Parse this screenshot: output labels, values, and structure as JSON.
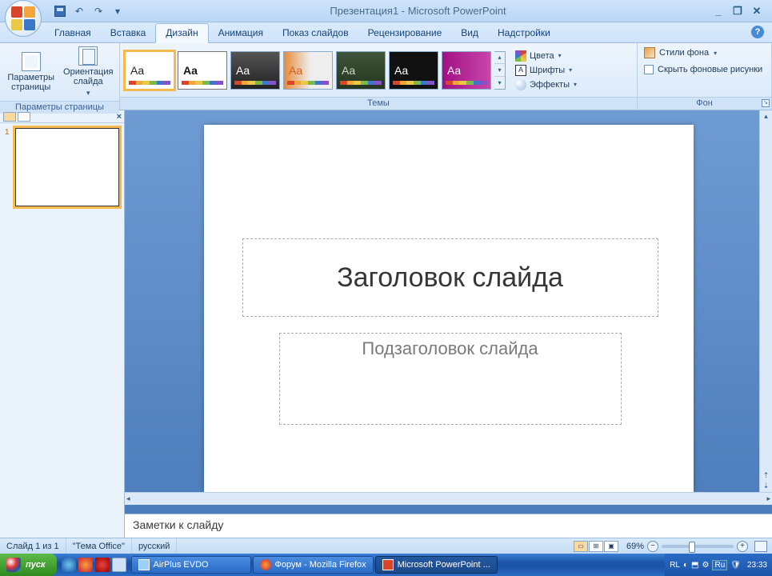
{
  "titlebar": {
    "title": "Презентация1 - Microsoft PowerPoint"
  },
  "qat": {
    "save": "save",
    "undo": "↶",
    "redo": "↷",
    "more": "▾"
  },
  "window_controls": {
    "min": "_",
    "restore": "❐",
    "close": "✕"
  },
  "tabs": {
    "items": [
      "Главная",
      "Вставка",
      "Дизайн",
      "Анимация",
      "Показ слайдов",
      "Рецензирование",
      "Вид",
      "Надстройки"
    ],
    "active_index": 2,
    "help": "?"
  },
  "ribbon": {
    "group_page": {
      "page_params": "Параметры страницы",
      "orientation": "Ориентация слайда",
      "label": "Параметры страницы"
    },
    "group_themes": {
      "label": "Темы",
      "sample": "Aa",
      "nav_up": "▴",
      "nav_down": "▾",
      "nav_more": "▾"
    },
    "group_theme_opts": {
      "colors": "Цвета",
      "fonts": "Шрифты",
      "effects": "Эффекты"
    },
    "group_bg": {
      "styles": "Стили фона",
      "hide": "Скрыть фоновые рисунки",
      "label": "Фон"
    }
  },
  "thumbs": {
    "slide_num": "1"
  },
  "slide": {
    "title_placeholder": "Заголовок слайда",
    "subtitle_placeholder": "Подзаголовок слайда"
  },
  "notes": {
    "placeholder": "Заметки к слайду"
  },
  "status": {
    "slide_info": "Слайд 1 из 1",
    "theme": "\"Тема Office\"",
    "lang": "русский",
    "zoom": "69%"
  },
  "taskbar": {
    "start": "пуск",
    "items": [
      {
        "label": "AirPlus EVDO",
        "pressed": false
      },
      {
        "label": "Форум - Mozilla Firefox",
        "pressed": false
      },
      {
        "label": "Microsoft PowerPoint ...",
        "pressed": true
      }
    ],
    "tray_lang1": "RL",
    "tray_lang2": "Ru",
    "clock": "23:33"
  }
}
